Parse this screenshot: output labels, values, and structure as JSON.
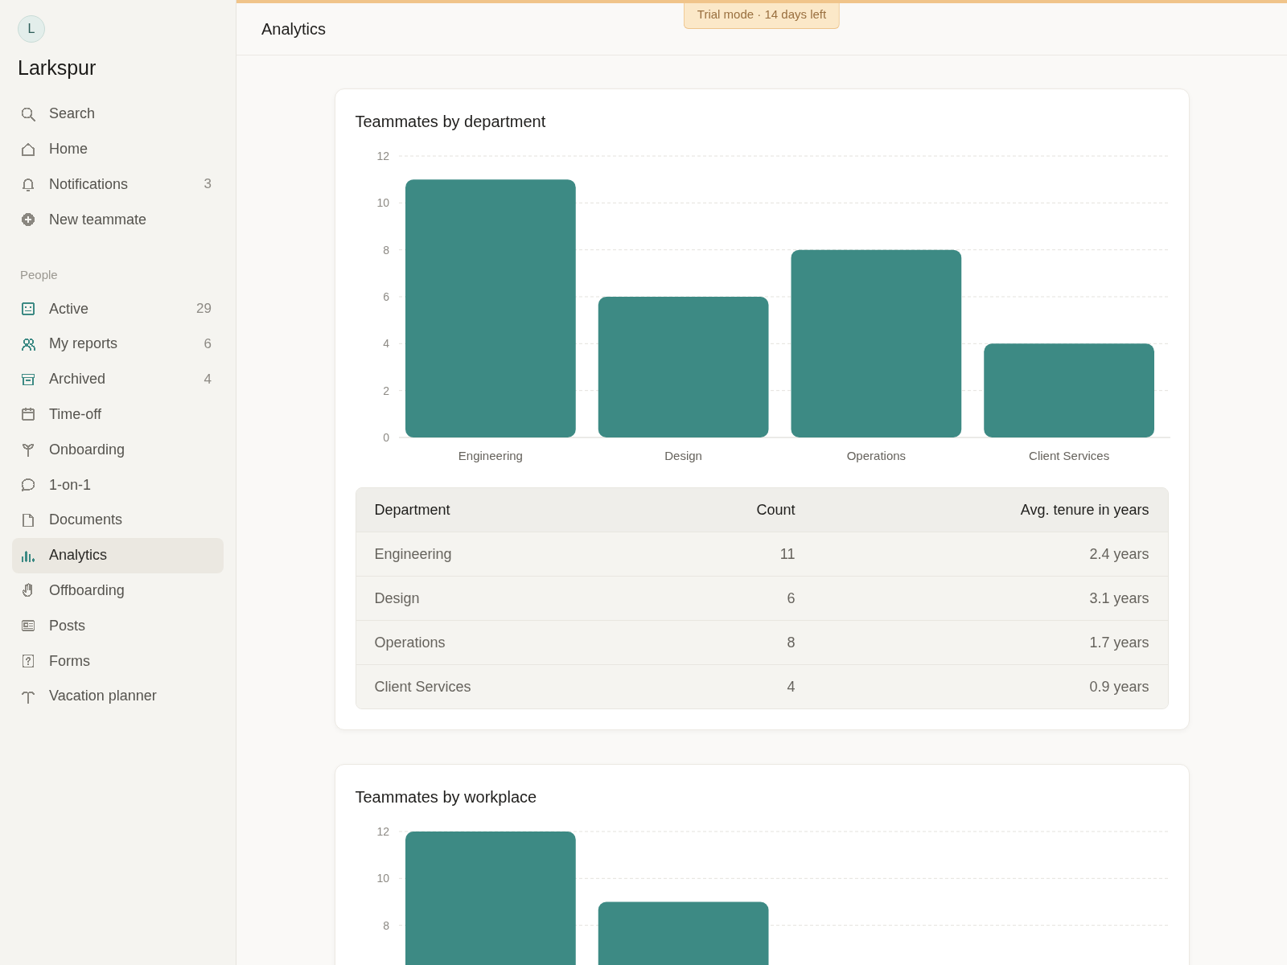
{
  "sidebar": {
    "avatar": "L",
    "workspace": "Larkspur",
    "top_items": [
      {
        "label": "Search",
        "color": "#8a8780",
        "selected": false
      },
      {
        "label": "Home",
        "color": "#8a8780",
        "selected": false
      },
      {
        "label": "Notifications",
        "count": "3",
        "color": "#8a8780",
        "selected": false
      },
      {
        "label": "New teammate",
        "color": "#8a8780",
        "selected": false
      }
    ],
    "section_label": "People",
    "items": [
      {
        "label": "Active",
        "count": "29",
        "color": "#3d8a84",
        "selected": false
      },
      {
        "label": "My reports",
        "count": "6",
        "color": "#3d8a84",
        "selected": false
      },
      {
        "label": "Archived",
        "count": "4",
        "color": "#3d8a84",
        "selected": false
      },
      {
        "label": "Time-off",
        "color": "#8a8780",
        "selected": false
      },
      {
        "label": "Onboarding",
        "color": "#8a8780",
        "selected": false
      },
      {
        "label": "1-on-1",
        "color": "#8a8780",
        "selected": false
      },
      {
        "label": "Documents",
        "color": "#8a8780",
        "selected": false
      },
      {
        "label": "Analytics",
        "color": "#3d8a84",
        "selected": true
      },
      {
        "label": "Offboarding",
        "color": "#8a8780",
        "selected": false
      },
      {
        "label": "Posts",
        "color": "#8a8780",
        "selected": false
      },
      {
        "label": "Forms",
        "color": "#8a8780",
        "selected": false
      },
      {
        "label": "Vacation planner",
        "color": "#8a8780",
        "selected": false
      }
    ]
  },
  "header": {
    "title": "Analytics",
    "trial_badge": "Trial mode · 14 days left"
  },
  "cards": [
    {
      "title": "Teammates by department",
      "chart_data": {
        "type": "bar",
        "categories": [
          "Engineering",
          "Design",
          "Operations",
          "Client Services"
        ],
        "values": [
          11,
          6,
          8,
          4
        ],
        "grid": true,
        "ylim": [
          0,
          12
        ],
        "yticks": [
          0,
          2,
          4,
          6,
          8,
          10,
          12
        ]
      },
      "table": {
        "columns": [
          "Department",
          "Count",
          "Avg. tenure in years"
        ],
        "rows": [
          [
            "Engineering",
            "11",
            "2.4 years"
          ],
          [
            "Design",
            "6",
            "3.1 years"
          ],
          [
            "Operations",
            "8",
            "1.7 years"
          ],
          [
            "Client Services",
            "4",
            "0.9 years"
          ]
        ]
      }
    },
    {
      "title": "Teammates by workplace",
      "chart_data": {
        "type": "bar",
        "values": [
          12,
          9,
          null,
          null
        ],
        "grid": true,
        "ylim": [
          0,
          12
        ],
        "yticks": [
          8,
          10,
          12
        ]
      }
    }
  ]
}
